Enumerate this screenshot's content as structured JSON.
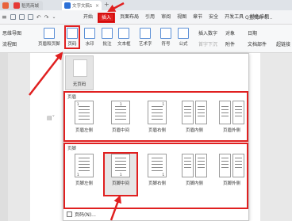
{
  "tabs": {
    "home_icon": "home-icon",
    "daoke_label": "稻壳商城",
    "doc_label": "文字文稿1"
  },
  "menu": {
    "items": [
      "开始",
      "插入",
      "页面布局",
      "引用",
      "审阅",
      "视图",
      "章节",
      "安全",
      "开发工具",
      "特色应用"
    ],
    "active": "插入",
    "search": "Q查找命令..."
  },
  "ribbon": {
    "left_top": "思维导图",
    "left_bottom": "流程图",
    "header_footer": "页眉和页脚",
    "page_number": "页码",
    "watermark": "水印",
    "annotation": "批注",
    "textbox": "文本框",
    "art": "艺术字",
    "symbol": "符号",
    "formula": "公式",
    "insert_number": "插入数字",
    "first_letter": "首字下沉",
    "object": "对象",
    "date": "日期",
    "attachment": "附件",
    "doc_parts": "文档部件",
    "hyperlink": "超链接"
  },
  "dropdown": {
    "no_page_number": "无页码",
    "header_group_title": "页眉",
    "footer_group_title": "页脚",
    "header_items": [
      "页眉左侧",
      "页眉中间",
      "页眉右侧",
      "页眉内侧",
      "页眉外侧"
    ],
    "footer_items": [
      "页脚左侧",
      "页脚中间",
      "页脚右侧",
      "页脚内侧",
      "页脚外侧"
    ],
    "selected": "页脚中间",
    "footer_link": "页码(N)..."
  },
  "colors": {
    "highlight_red": "#e02020",
    "accent_blue": "#2b6fd6"
  }
}
